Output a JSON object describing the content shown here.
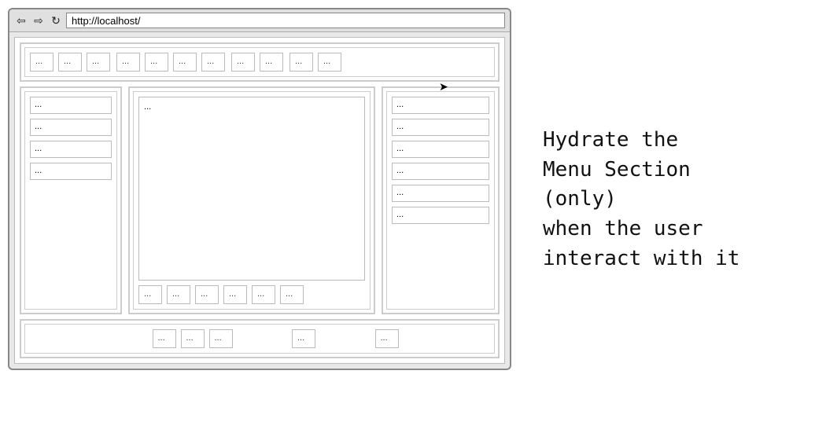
{
  "browser": {
    "url": "http://localhost/",
    "nav": {
      "back": "⇦",
      "forward": "⇨",
      "reload": "↻"
    }
  },
  "placeholder": "...",
  "topnav": {
    "group1": [
      "...",
      "...",
      "..."
    ],
    "group2": [
      "...",
      "...",
      "...",
      "..."
    ],
    "group3": [
      "...",
      "..."
    ],
    "group4": [
      "...",
      "..."
    ]
  },
  "left_sidebar": {
    "items": [
      "...",
      "...",
      "...",
      "..."
    ]
  },
  "center": {
    "main": "...",
    "thumbs": [
      "...",
      "...",
      "...",
      "...",
      "...",
      "..."
    ]
  },
  "right_sidebar": {
    "items": [
      "...",
      "...",
      "...",
      "...",
      "...",
      "..."
    ]
  },
  "footer": {
    "group_left": [
      "...",
      "...",
      "..."
    ],
    "group_mid": [
      "..."
    ],
    "group_right": [
      "..."
    ]
  },
  "caption": {
    "line1": "Hydrate the",
    "line2": "Menu Section",
    "line3": "(only)",
    "line4": "when the user",
    "line5": "interact with it"
  }
}
